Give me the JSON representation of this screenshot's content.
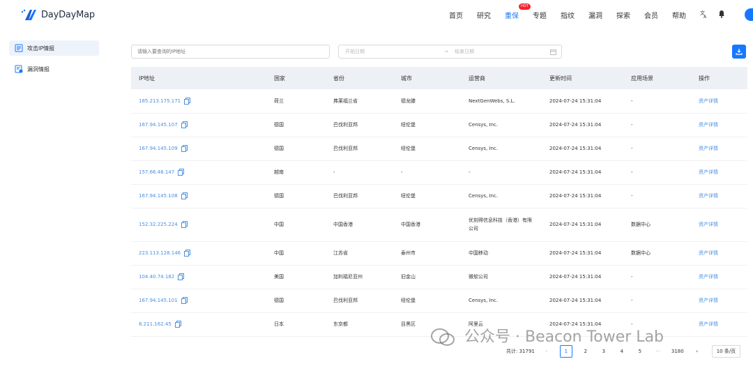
{
  "brand": {
    "name": "DayDayMap",
    "accent": "#1677ff"
  },
  "nav": [
    {
      "label": "首页"
    },
    {
      "label": "研究"
    },
    {
      "label": "重保",
      "badge": "HOT"
    },
    {
      "label": "专题"
    },
    {
      "label": "指纹"
    },
    {
      "label": "漏洞"
    },
    {
      "label": "探索"
    },
    {
      "label": "会员"
    },
    {
      "label": "帮助"
    }
  ],
  "nav_icons": [
    "translate-icon",
    "bell-icon",
    "avatar"
  ],
  "sidebar": [
    {
      "label": "攻击IP情报",
      "icon": "threat-intel-icon",
      "active": true
    },
    {
      "label": "漏洞情报",
      "icon": "vuln-intel-icon",
      "active": false
    }
  ],
  "filters": {
    "search_placeholder": "请输入要查询的IP地址",
    "start_placeholder": "开始日期",
    "end_placeholder": "结束日期",
    "range_arrow": "→"
  },
  "table": {
    "columns": [
      "IP地址",
      "国家",
      "省份",
      "城市",
      "运营商",
      "更新时间",
      "应用场景",
      "操作"
    ],
    "rows": [
      [
        "185.213.175.171",
        "荷兰",
        "弗莱福兰省",
        "德龙滕",
        "NextGenWebs, S.L.",
        "2024-07-24 15:31:04",
        "-",
        "资产详情"
      ],
      [
        "167.94.145.107",
        "德国",
        "巴伐利亚邦",
        "纽伦堡",
        "Censys, Inc.",
        "2024-07-24 15:31:04",
        "-",
        "资产详情"
      ],
      [
        "167.94.145.109",
        "德国",
        "巴伐利亚邦",
        "纽伦堡",
        "Censys, Inc.",
        "2024-07-24 15:31:04",
        "-",
        "资产详情"
      ],
      [
        "157.66.48.147",
        "越南",
        "-",
        "-",
        "-",
        "2024-07-24 15:31:04",
        "-",
        "资产详情"
      ],
      [
        "167.94.145.108",
        "德国",
        "巴伐利亚邦",
        "纽伦堡",
        "Censys, Inc.",
        "2024-07-24 15:31:04",
        "-",
        "资产详情"
      ],
      [
        "152.32.225.224",
        "中国",
        "中国香港",
        "中国香港",
        "优刻得信息科技（香港）有限公司",
        "2024-07-24 15:31:04",
        "数据中心",
        "资产详情"
      ],
      [
        "223.113.128.146",
        "中国",
        "江苏省",
        "泰州市",
        "中国移动",
        "2024-07-24 15:31:04",
        "数据中心",
        "资产详情"
      ],
      [
        "104.40.74.182",
        "美国",
        "加利福尼亚州",
        "旧金山",
        "微软公司",
        "2024-07-24 15:31:04",
        "-",
        "资产详情"
      ],
      [
        "167.94.145.101",
        "德国",
        "巴伐利亚邦",
        "纽伦堡",
        "Censys, Inc.",
        "2024-07-24 15:31:04",
        "-",
        "资产详情"
      ],
      [
        "8.211.162.45",
        "日本",
        "东京都",
        "目黑区",
        "阿里云",
        "2024-07-24 15:31:04",
        "-",
        "资产详情"
      ]
    ]
  },
  "pagination": {
    "total_label": "共计: 31791",
    "prev": "‹",
    "next": "›",
    "pages": [
      "1",
      "2",
      "3",
      "4",
      "5",
      "···",
      "3180"
    ],
    "current": "1",
    "page_size": "10 条/页"
  },
  "watermark": "公众号 · Beacon Tower Lab"
}
